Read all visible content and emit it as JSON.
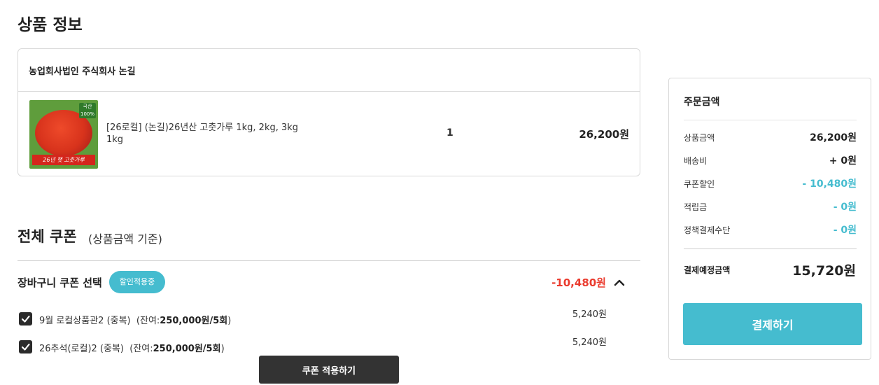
{
  "product_section": {
    "title": "상품 정보",
    "seller": "농업회사법인 주식회사 논길",
    "item": {
      "thumbnail_badge": "국산 100%",
      "thumbnail_caption": "26년 햇 고춧가루",
      "name": "[26로컬] (논길)26년산 고춧가루 1kg, 2kg, 3kg 1kg",
      "quantity": "1",
      "price": "26,200원"
    }
  },
  "coupon_section": {
    "title": "전체 쿠폰",
    "subtitle": "(상품금액 기준)",
    "cart_coupon_label": "장바구니 쿠폰 선택",
    "applied_badge": "할인적용중",
    "cart_coupon_total": "-10,480원",
    "coupons": [
      {
        "name": "9월 로컬상품관2 (중복)",
        "remain_prefix": "(잔여:",
        "remain_value": "250,000원/5회",
        "remain_suffix": ")",
        "amount": "5,240원",
        "checked": true
      },
      {
        "name": "26추석(로컬)2 (중복)",
        "remain_prefix": "(잔여:",
        "remain_value": "250,000원/5회",
        "remain_suffix": ")",
        "amount": "5,240원",
        "checked": true
      }
    ],
    "apply_button": "쿠폰 적용하기"
  },
  "summary": {
    "title": "주문금액",
    "rows": [
      {
        "label": "상품금액",
        "value": "26,200원"
      },
      {
        "label": "배송비",
        "value": "+ 0원"
      },
      {
        "label": "쿠폰할인",
        "value": "- 10,480원"
      },
      {
        "label": "적립금",
        "value": "- 0원"
      },
      {
        "label": "정책결제수단",
        "value": "- 0원"
      }
    ],
    "total_label": "결제예정금액",
    "total_value": "15,720원",
    "pay_button": "결제하기"
  },
  "colors": {
    "accent": "#45bccf",
    "discount_red": "#ea3b2e",
    "dark_button": "#333333"
  }
}
